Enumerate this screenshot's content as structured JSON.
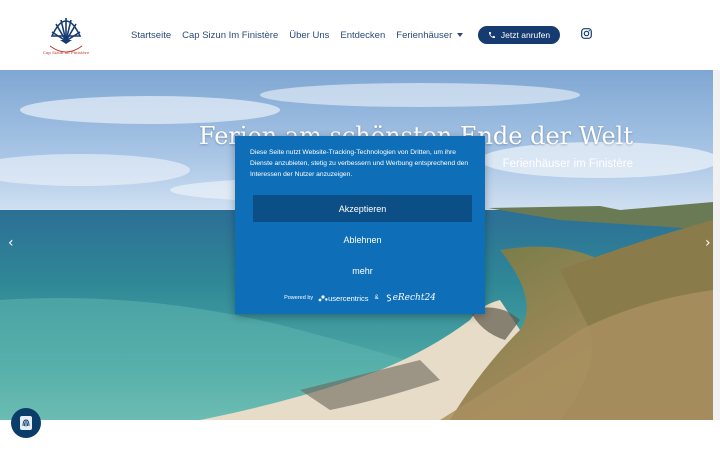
{
  "header": {
    "logo": {
      "caption": "Cap Sizun im Finistère",
      "brand_color": "#163b70",
      "accent_color": "#c0392b"
    },
    "nav": [
      {
        "label": "Startseite"
      },
      {
        "label": "Cap Sizun Im Finistère"
      },
      {
        "label": "Über Uns"
      },
      {
        "label": "Entdecken"
      },
      {
        "label": "Ferienhäuser",
        "has_dropdown": true
      }
    ],
    "call_button": {
      "label": "Jetzt anrufen",
      "icon": "phone-icon"
    },
    "social": {
      "icon": "instagram-icon"
    }
  },
  "hero": {
    "title": "Ferien am schönsten Ende der Welt",
    "subtitle": "Ferienhäuser im Finistère",
    "prev_icon": "‹",
    "next_icon": "›"
  },
  "consent": {
    "text": "Diese Seite nutzt Website-Tracking-Technologien von Dritten, um ihre Dienste anzubieten, stetig zu verbessern und Werbung entsprechend den Interessen der Nutzer anzuzeigen.",
    "accept_label": "Akzeptieren",
    "reject_label": "Ablehnen",
    "more_label": "mehr",
    "powered_by": "Powered by",
    "usercentrics": "usercentrics",
    "ampersand": "&",
    "erecht": "eRecht24",
    "background": "#0e6fb8",
    "button_color": "#0b4f86"
  },
  "privacy_button": {
    "icon": "fingerprint-icon"
  }
}
